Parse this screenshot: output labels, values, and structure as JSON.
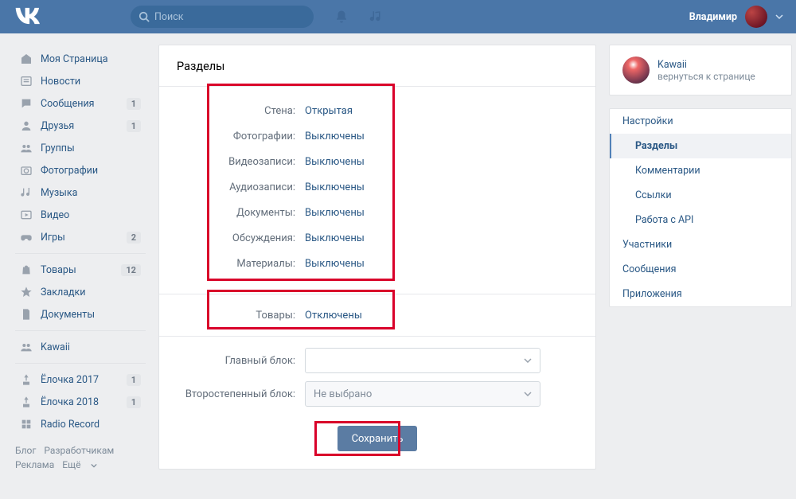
{
  "header": {
    "search_placeholder": "Поиск",
    "username": "Владимир"
  },
  "nav": {
    "items": [
      {
        "label": "Моя Страница",
        "icon": "home"
      },
      {
        "label": "Новости",
        "icon": "news"
      },
      {
        "label": "Сообщения",
        "icon": "msg",
        "badge": "1"
      },
      {
        "label": "Друзья",
        "icon": "friend",
        "badge": "1"
      },
      {
        "label": "Группы",
        "icon": "groups"
      },
      {
        "label": "Фотографии",
        "icon": "photo"
      },
      {
        "label": "Музыка",
        "icon": "music"
      },
      {
        "label": "Видео",
        "icon": "video"
      },
      {
        "label": "Игры",
        "icon": "games",
        "badge": "2"
      }
    ],
    "items2": [
      {
        "label": "Товары",
        "icon": "bag",
        "badge": "12"
      },
      {
        "label": "Закладки",
        "icon": "star"
      },
      {
        "label": "Документы",
        "icon": "doc"
      }
    ],
    "items3": [
      {
        "label": "Kawaii",
        "icon": "groups"
      }
    ],
    "items4": [
      {
        "label": "Ёлочка 2017",
        "icon": "app",
        "badge": "1"
      },
      {
        "label": "Ёлочка 2018",
        "icon": "app",
        "badge": "1"
      },
      {
        "label": "Radio Record",
        "icon": "app2"
      }
    ]
  },
  "footer": {
    "blog": "Блог",
    "dev": "Разработчикам",
    "ads": "Реклама",
    "more": "Ещё"
  },
  "main": {
    "title": "Разделы",
    "rows": [
      {
        "label": "Стена:",
        "value": "Открытая"
      },
      {
        "label": "Фотографии:",
        "value": "Выключены"
      },
      {
        "label": "Видеозаписи:",
        "value": "Выключены"
      },
      {
        "label": "Аудиозаписи:",
        "value": "Выключены"
      },
      {
        "label": "Документы:",
        "value": "Выключены"
      },
      {
        "label": "Обсуждения:",
        "value": "Выключены"
      },
      {
        "label": "Материалы:",
        "value": "Выключены"
      }
    ],
    "goods": {
      "label": "Товары:",
      "value": "Отключены"
    },
    "mainblock_label": "Главный блок:",
    "secblock_label": "Второстепенный блок:",
    "secblock_value": "Не выбрано",
    "save": "Сохранить"
  },
  "right": {
    "group_name": "Kawaii",
    "back": "вернуться к странице",
    "menu": [
      {
        "label": "Настройки",
        "sub": false,
        "active": false
      },
      {
        "label": "Разделы",
        "sub": true,
        "active": true
      },
      {
        "label": "Комментарии",
        "sub": true,
        "active": false
      },
      {
        "label": "Ссылки",
        "sub": true,
        "active": false
      },
      {
        "label": "Работа с API",
        "sub": true,
        "active": false
      },
      {
        "label": "Участники",
        "sub": false,
        "active": false
      },
      {
        "label": "Сообщения",
        "sub": false,
        "active": false
      },
      {
        "label": "Приложения",
        "sub": false,
        "active": false
      }
    ]
  }
}
